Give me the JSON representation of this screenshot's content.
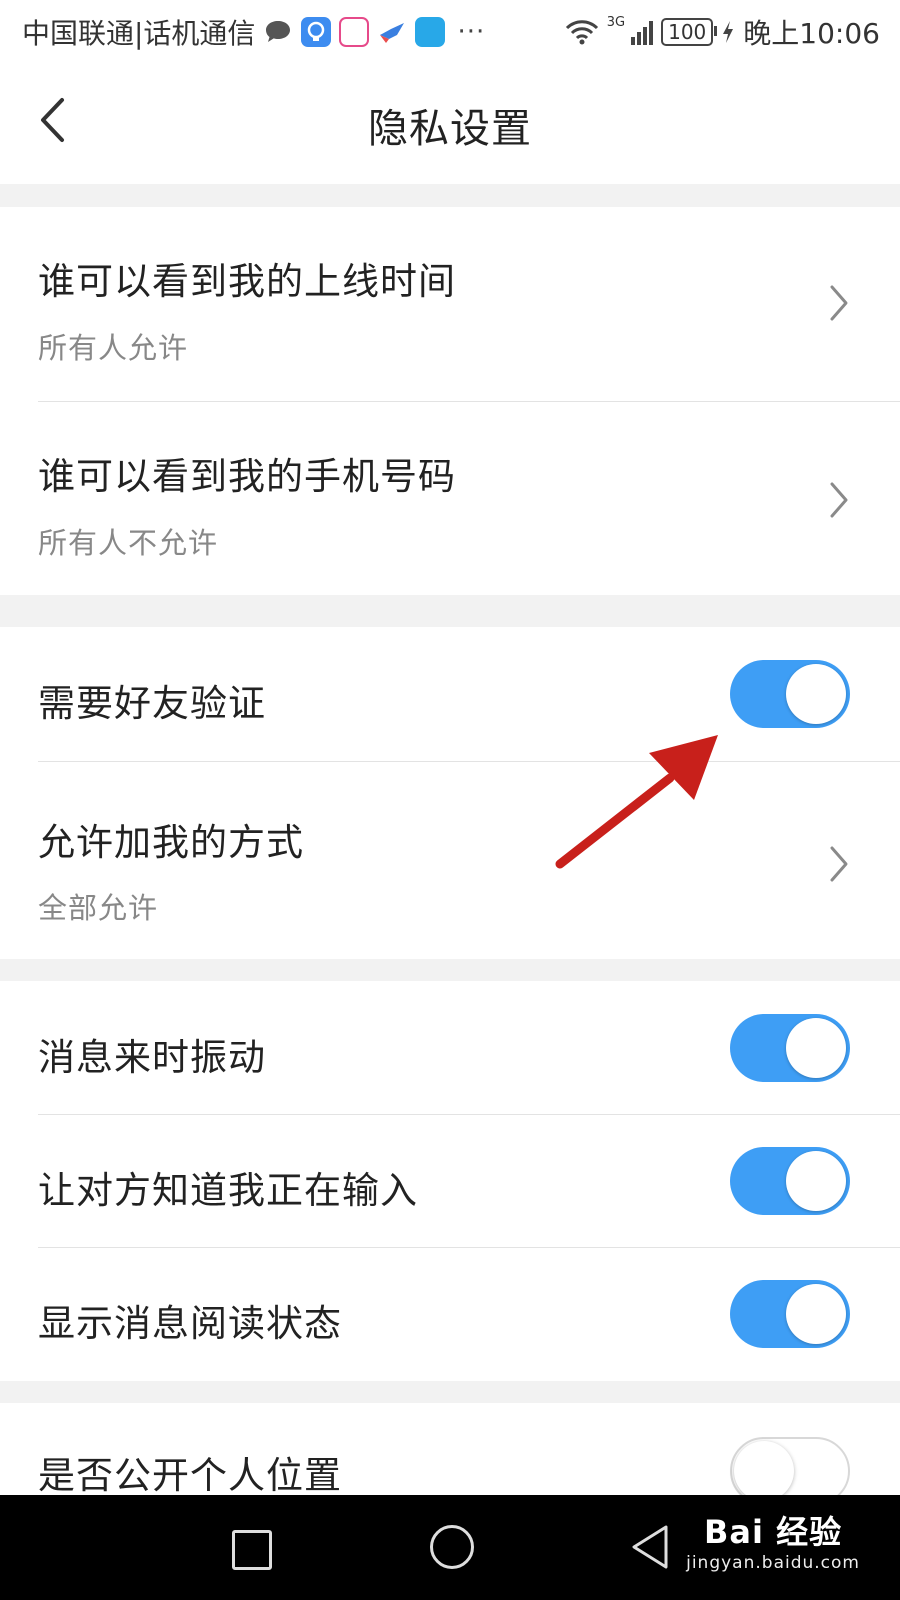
{
  "status_bar": {
    "carrier": "中国联通|话机通信",
    "more": "···",
    "network": "3G",
    "battery": "100",
    "time": "晚上10:06"
  },
  "header": {
    "title": "隐私设置",
    "back_icon": "chevron-left-icon"
  },
  "sections": [
    {
      "items": [
        {
          "title": "谁可以看到我的上线时间",
          "subtitle": "所有人允许",
          "control": "chevron"
        },
        {
          "title": "谁可以看到我的手机号码",
          "subtitle": "所有人不允许",
          "control": "chevron"
        }
      ]
    },
    {
      "items": [
        {
          "title": "需要好友验证",
          "control": "toggle",
          "on": true
        },
        {
          "title": "允许加我的方式",
          "subtitle": "全部允许",
          "control": "chevron"
        }
      ]
    },
    {
      "items": [
        {
          "title": "消息来时振动",
          "control": "toggle",
          "on": true
        },
        {
          "title": "让对方知道我正在输入",
          "control": "toggle",
          "on": true
        },
        {
          "title": "显示消息阅读状态",
          "control": "toggle",
          "on": true
        }
      ]
    },
    {
      "items": [
        {
          "title": "是否公开个人位置",
          "control": "toggle",
          "on": false
        }
      ]
    }
  ],
  "nav_bar": {
    "icons": [
      "recents-square-icon",
      "home-circle-icon",
      "back-triangle-icon"
    ]
  },
  "watermark": {
    "brand": "Bai 经验",
    "url": "jingyan.baidu.com"
  },
  "colors": {
    "toggle_on": "#3e9ef5",
    "annotation_arrow": "#c8201b"
  }
}
